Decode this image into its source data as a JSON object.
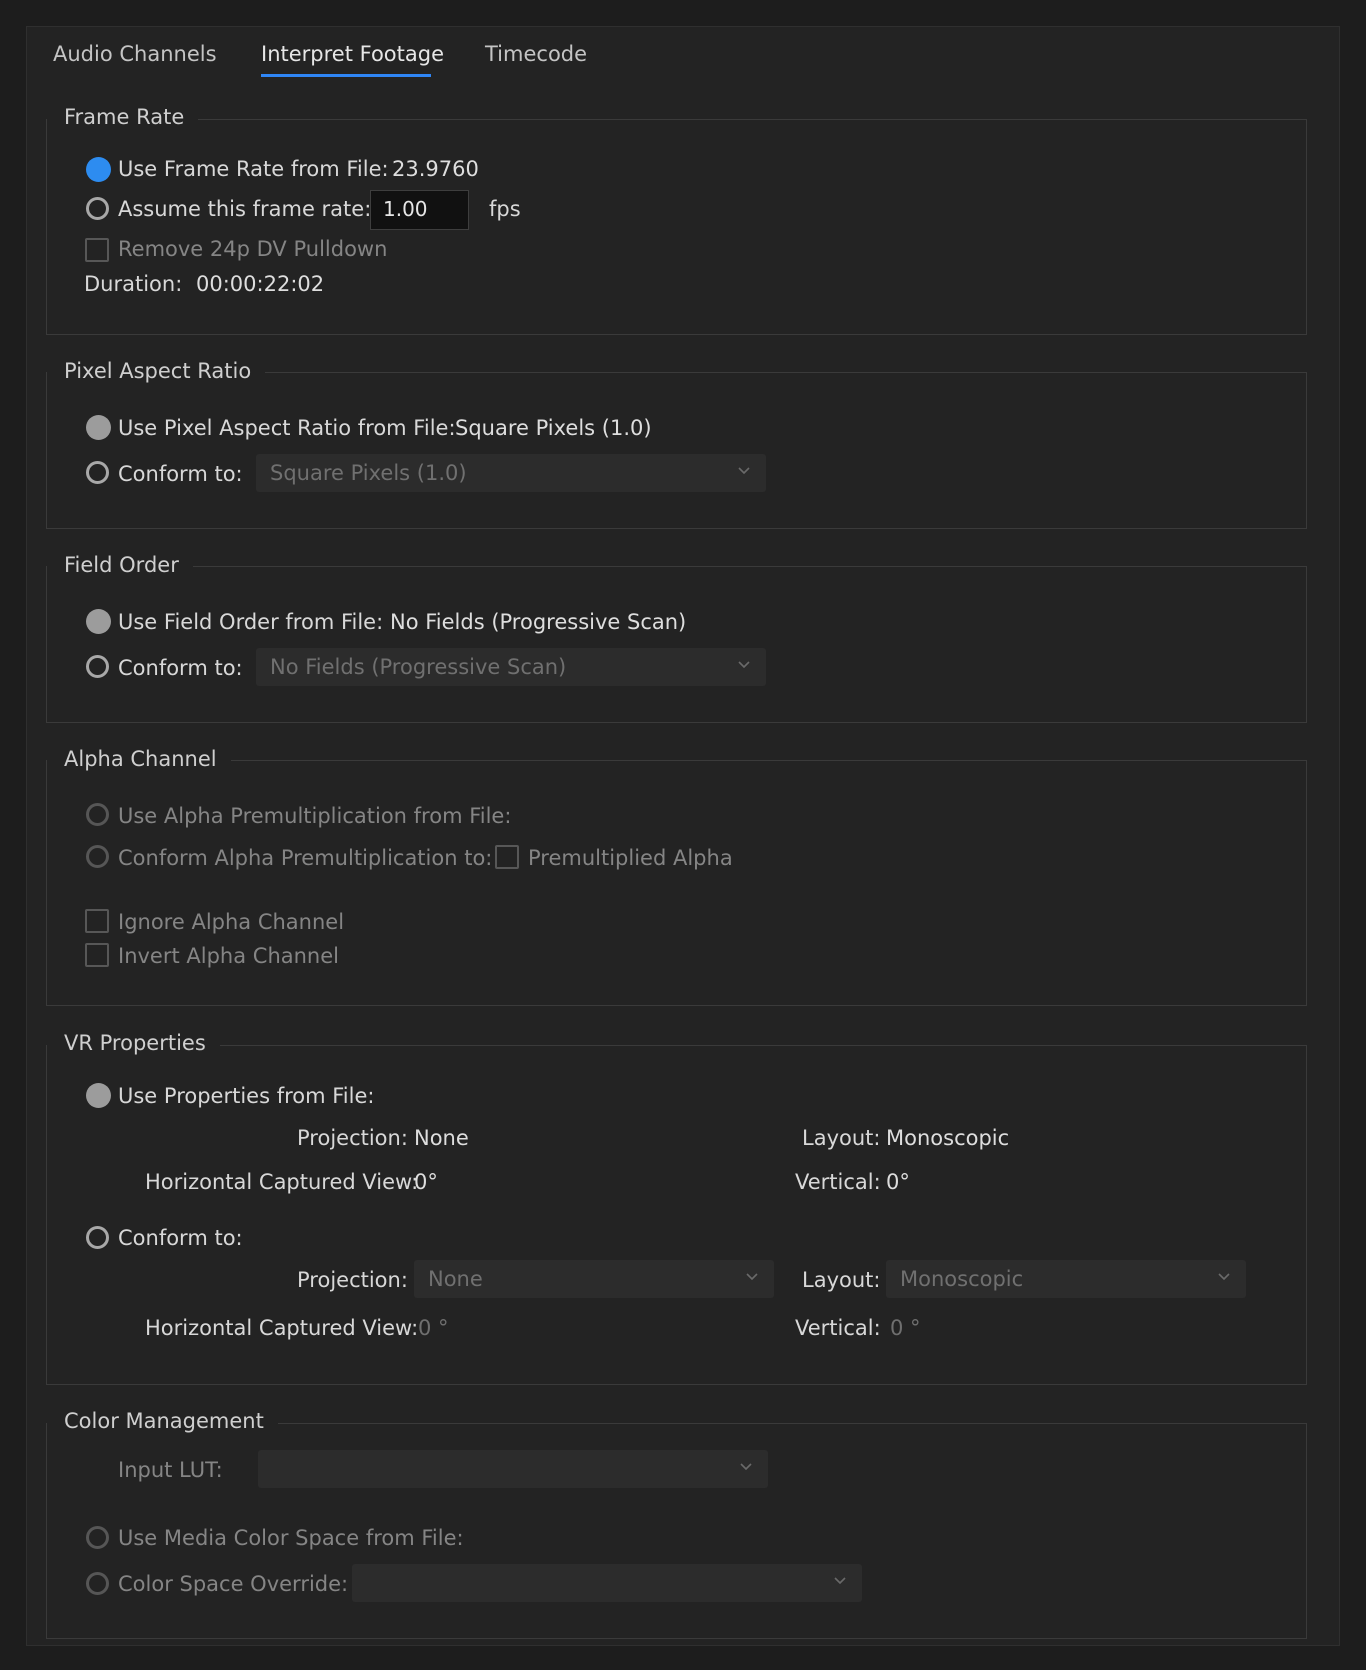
{
  "tabs": [
    "Audio Channels",
    "Interpret Footage",
    "Timecode"
  ],
  "active_tab": "Interpret Footage",
  "frame_rate": {
    "legend": "Frame Rate",
    "use_from_file_label": "Use Frame Rate from File:",
    "file_rate_value": "23.9760",
    "assume_label": "Assume this frame rate:",
    "assume_value": "1.00",
    "fps_label": "fps",
    "remove_pulldown_label": "Remove 24p DV Pulldown",
    "duration_label": "Duration:",
    "duration_value": "00:00:22:02"
  },
  "pixel_aspect_ratio": {
    "legend": "Pixel Aspect Ratio",
    "use_from_file_label": "Use Pixel Aspect Ratio from File:",
    "file_value": "Square Pixels (1.0)",
    "conform_label": "Conform to:",
    "conform_selected": "Square Pixels (1.0)"
  },
  "field_order": {
    "legend": "Field Order",
    "use_from_file_label": "Use Field Order from File:",
    "file_value": "No Fields (Progressive Scan)",
    "conform_label": "Conform to:",
    "conform_selected": "No Fields (Progressive Scan)"
  },
  "alpha_channel": {
    "legend": "Alpha Channel",
    "use_premult_label": "Use Alpha Premultiplication from File:",
    "conform_premult_label": "Conform Alpha Premultiplication to:",
    "premultiplied_label": "Premultiplied Alpha",
    "ignore_label": "Ignore Alpha Channel",
    "invert_label": "Invert Alpha Channel"
  },
  "vr_properties": {
    "legend": "VR Properties",
    "use_from_file_label": "Use Properties from File:",
    "projection_label": "Projection:",
    "projection_value": "None",
    "layout_label": "Layout:",
    "layout_value": "Monoscopic",
    "hcv_label": "Horizontal Captured View:",
    "hcv_value": "0°",
    "vertical_label": "Vertical:",
    "vertical_value": "0°",
    "conform_label": "Conform to:",
    "conform_projection_label": "Projection:",
    "conform_projection_selected": "None",
    "conform_layout_label": "Layout:",
    "conform_layout_selected": "Monoscopic",
    "conform_hcv_label": "Horizontal Captured View:",
    "conform_hcv_value": "0 °",
    "conform_vertical_label": "Vertical:",
    "conform_vertical_value": "0 °"
  },
  "color_management": {
    "legend": "Color Management",
    "input_lut_label": "Input LUT:",
    "input_lut_selected": "",
    "use_media_cs_label": "Use Media Color Space from File:",
    "override_label": "Color Space Override:",
    "override_selected": ""
  },
  "colors": {
    "accent": "#2d8cf0",
    "background": "#232323",
    "text": "#d8d8d8",
    "disabled_text": "#858585"
  }
}
